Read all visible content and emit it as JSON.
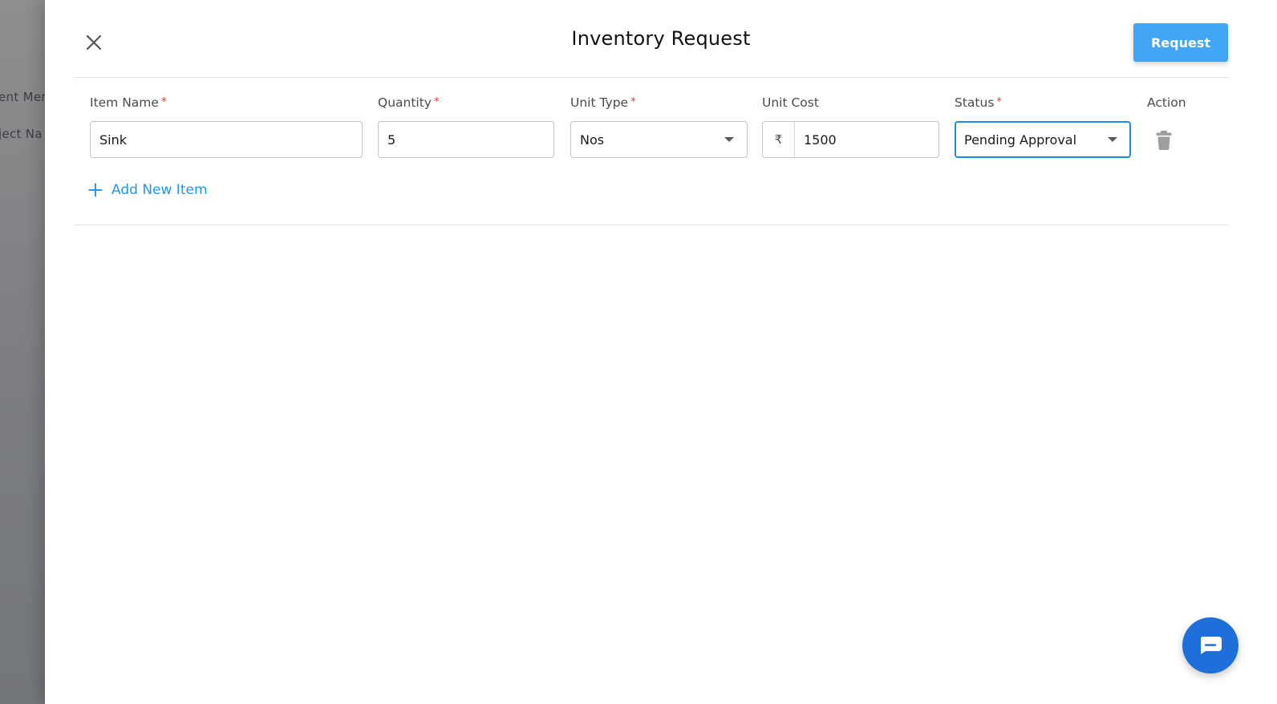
{
  "background": {
    "text_lines": [
      "ent Mene",
      "ject Na"
    ]
  },
  "dialog": {
    "title": "Inventory Request",
    "request_label": "Request",
    "close_icon": "close-icon"
  },
  "form": {
    "columns": {
      "item_name": "Item Name",
      "quantity": "Quantity",
      "unit_type": "Unit Type",
      "unit_cost": "Unit Cost",
      "status": "Status",
      "action": "Action"
    },
    "required_mark": "*",
    "row": {
      "item_name": "Sink",
      "quantity": "5",
      "unit_type": "Nos",
      "currency_symbol": "₹",
      "unit_cost": "1500",
      "status": "Pending Approval",
      "delete_icon": "trash-icon"
    },
    "add_item_label": "Add New Item"
  },
  "chat": {
    "icon": "chat-bubble-icon"
  },
  "colors": {
    "primary": "#42a5f5",
    "link": "#2196f3",
    "required": "#e53935",
    "focus_border": "#1e88e5",
    "chat_fab": "#1e6fd9"
  }
}
